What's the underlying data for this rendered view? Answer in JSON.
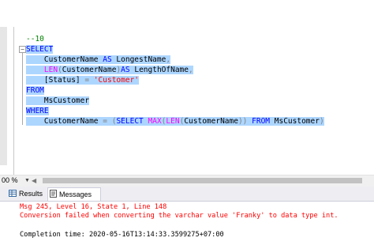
{
  "editor": {
    "lines": [
      [
        {
          "t": "--10",
          "c": "cm"
        }
      ],
      [
        {
          "t": "SELECT",
          "c": "kw"
        }
      ],
      [
        {
          "t": "    CustomerName ",
          "c": ""
        },
        {
          "t": "AS",
          "c": "kw"
        },
        {
          "t": " LongestName",
          "c": ""
        },
        {
          "t": ",",
          "c": "op"
        }
      ],
      [
        {
          "t": "    ",
          "c": ""
        },
        {
          "t": "LEN",
          "c": "fn"
        },
        {
          "t": "(",
          "c": "op"
        },
        {
          "t": "CustomerName",
          "c": ""
        },
        {
          "t": ")",
          "c": "op"
        },
        {
          "t": "AS",
          "c": "kw"
        },
        {
          "t": " LengthOfName",
          "c": ""
        },
        {
          "t": ",",
          "c": "op"
        }
      ],
      [
        {
          "t": "    [Status] ",
          "c": ""
        },
        {
          "t": "=",
          "c": "op"
        },
        {
          "t": " ",
          "c": ""
        },
        {
          "t": "'Customer'",
          "c": "str"
        }
      ],
      [
        {
          "t": "FROM",
          "c": "kw"
        }
      ],
      [
        {
          "t": "    MsCustomer",
          "c": ""
        }
      ],
      [
        {
          "t": "WHERE",
          "c": "kw"
        }
      ],
      [
        {
          "t": "    CustomerName ",
          "c": ""
        },
        {
          "t": "=",
          "c": "op"
        },
        {
          "t": " ",
          "c": ""
        },
        {
          "t": "(",
          "c": "op"
        },
        {
          "t": "SELECT",
          "c": "kw"
        },
        {
          "t": " ",
          "c": ""
        },
        {
          "t": "MAX",
          "c": "fn"
        },
        {
          "t": "(",
          "c": "op"
        },
        {
          "t": "LEN",
          "c": "fn"
        },
        {
          "t": "(",
          "c": "op"
        },
        {
          "t": "CustomerName",
          "c": ""
        },
        {
          "t": "))",
          "c": "op"
        },
        {
          "t": " ",
          "c": ""
        },
        {
          "t": "FROM",
          "c": "kw"
        },
        {
          "t": " MsCustomer",
          "c": ""
        },
        {
          "t": ")",
          "c": "op"
        }
      ]
    ]
  },
  "statusbar": {
    "zoom": "00 %"
  },
  "tabs": {
    "results": "Results",
    "messages": "Messages"
  },
  "messages": {
    "line1": "Msg 245, Level 16, State 1, Line 148",
    "line2": "Conversion failed when converting the varchar value 'Franky' to data type int.",
    "line3": "Completion time: 2020-05-16T13:14:33.3599275+07:00"
  },
  "colors": {
    "keyword": "#0000ff",
    "function": "#ff00ff",
    "string": "#ff0000",
    "comment": "#008000",
    "selection": "#add6ff",
    "error": "#ff0000"
  }
}
